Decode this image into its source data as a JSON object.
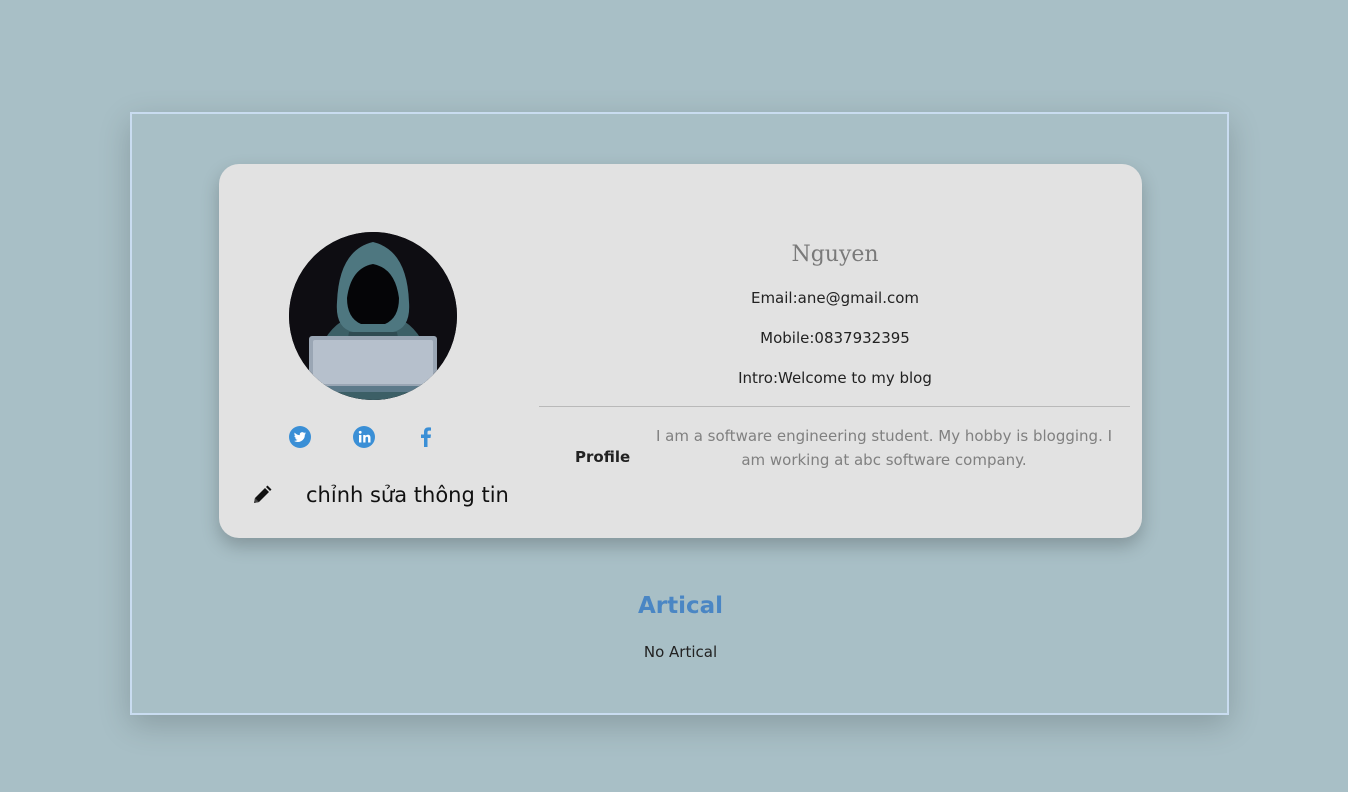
{
  "profile": {
    "name": "Nguyen",
    "email_line": "Email:ane@gmail.com",
    "mobile_line": "Mobile:0837932395",
    "intro_line": "Intro:Welcome to my blog",
    "profile_label": "Profile",
    "profile_text": "I am a software engineering student. My hobby is blogging. I am working at abc software company."
  },
  "socials": [
    {
      "icon": "twitter-icon",
      "color": "#3a8fd6"
    },
    {
      "icon": "linkedin-icon",
      "color": "#3a8fd6"
    },
    {
      "icon": "facebook-icon",
      "color": "#3a8fd6"
    }
  ],
  "edit": {
    "icon": "pencil-icon",
    "label": "chỉnh sửa thông tin"
  },
  "articles": {
    "title": "Artical",
    "empty_text": "No Artical"
  },
  "colors": {
    "background": "#a8bfc6",
    "card": "#e2e2e2",
    "accent": "#4a86c4"
  }
}
